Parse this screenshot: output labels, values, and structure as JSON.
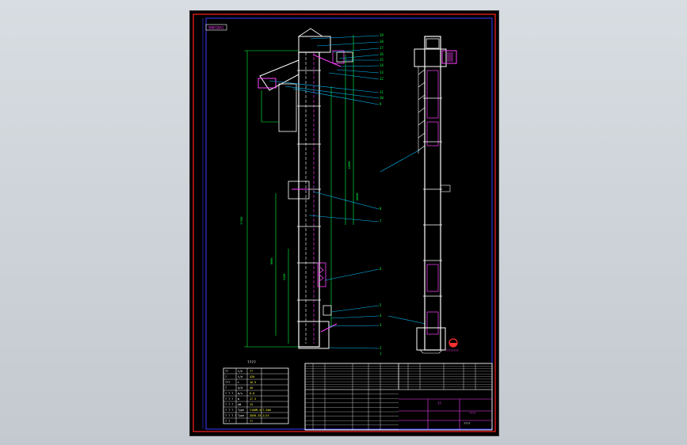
{
  "sheet_tag": "SB0520A1",
  "balloons": [
    "19",
    "18",
    "17",
    "16",
    "15",
    "14",
    "13",
    "12",
    "11",
    "10",
    "9",
    "8",
    "7",
    "6",
    "5",
    "4",
    "3",
    "2",
    "1"
  ],
  "params_title": "????",
  "params_table": {
    "headers": [
      "??",
      "t/h",
      "??"
    ],
    "rows": [
      [
        "?",
        "t/d",
        "420"
      ],
      [
        "???",
        "t",
        "10.5"
      ],
      [
        "?",
        "d/d",
        "40"
      ],
      [
        "? ? ?",
        "m/s",
        "0.8"
      ],
      [
        "? ? ?",
        "m",
        "17.3"
      ],
      [
        "? ? ?",
        "kW",
        "15"
      ],
      [
        "? ? ?",
        "Type",
        "Y160M-4/7.5kW"
      ],
      [
        "? ? ? ?",
        "Type",
        "ZQ50-25-1/2X"
      ],
      [
        "? ?",
        "",
        "??"
      ]
    ]
  },
  "title_block": {
    "drawing_name": "??",
    "drawing_no": "????",
    "company": "????"
  },
  "logo_text": "????????"
}
